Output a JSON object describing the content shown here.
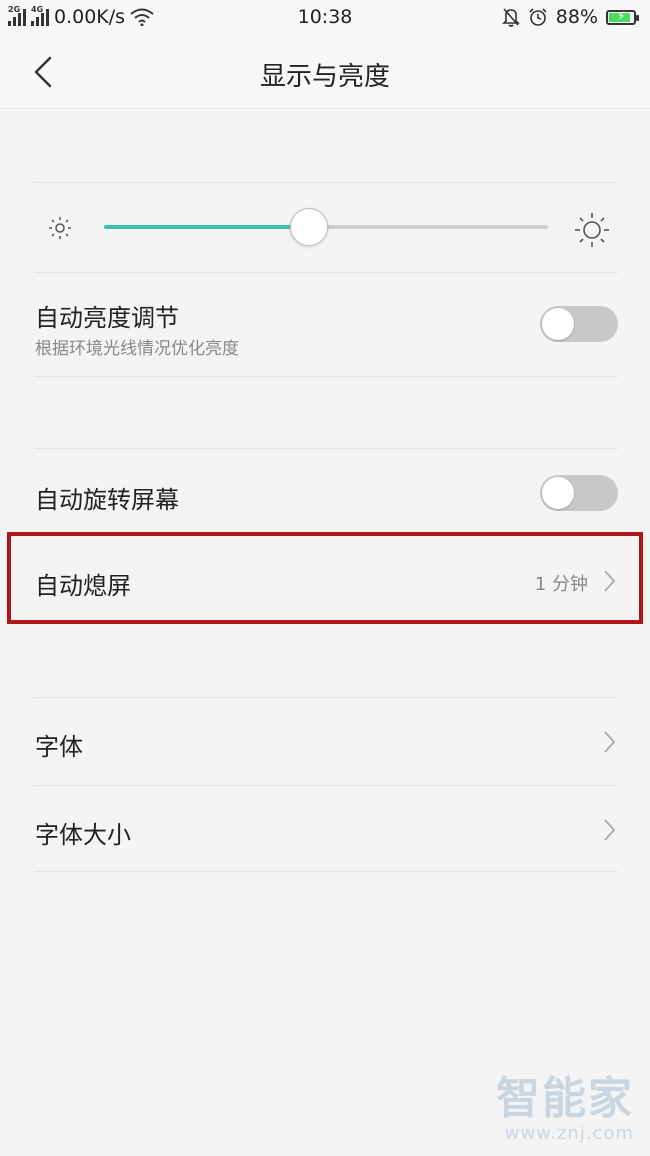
{
  "status_bar": {
    "network_speed": "0.00K/s",
    "signal_tag_1": "2G",
    "signal_tag_2": "4G",
    "time": "10:38",
    "battery_percent": "88%",
    "battery_level": 0.88
  },
  "nav": {
    "title": "显示与亮度",
    "back_icon": "chevron-left-icon"
  },
  "brightness": {
    "value": 0.46,
    "low_icon": "sun-small-icon",
    "high_icon": "sun-large-icon",
    "accent_color": "#3fbfa8"
  },
  "settings": {
    "auto_brightness": {
      "title": "自动亮度调节",
      "subtitle": "根据环境光线情况优化亮度",
      "on": false
    },
    "auto_rotate": {
      "title": "自动旋转屏幕",
      "on": false
    },
    "auto_screen_off": {
      "title": "自动熄屏",
      "value": "1 分钟"
    },
    "font": {
      "title": "字体"
    },
    "font_size": {
      "title": "字体大小"
    }
  },
  "highlight_color": "#b01818",
  "watermark": {
    "main": "智能家",
    "url": "www.znj.com"
  }
}
